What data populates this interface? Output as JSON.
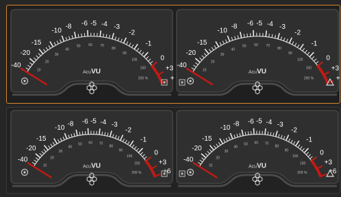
{
  "product": {
    "brand_prefix": "Acu",
    "brand_suffix": "VU"
  },
  "scale": {
    "labels": [
      "-40",
      "-20",
      "-15",
      "-10",
      "-8",
      "-6",
      "-5",
      "-4",
      "-3",
      "-2",
      "-1",
      "0",
      "+3",
      "+6"
    ],
    "percent_labels": [
      "10",
      "20",
      "30",
      "40",
      "50",
      "60",
      "70",
      "80",
      "90",
      "100",
      "150"
    ],
    "percent_end_label": "200 %"
  },
  "colors": {
    "panel": "#2f2f2f",
    "panel_bezel": "#3e3e3e",
    "scale_text": "#ffffff",
    "red_zone": "#c21a14",
    "needle": "#c21a14",
    "selected_border": "#d8882a"
  },
  "meters": [
    {
      "group": "top",
      "side": "left",
      "needle_db": -40
    },
    {
      "group": "top",
      "side": "right",
      "needle_db": -40
    },
    {
      "group": "bottom",
      "side": "left",
      "needle_db": -40
    },
    {
      "group": "bottom",
      "side": "right",
      "needle_db": -40
    }
  ],
  "icons": {
    "meter_bottom_left": "vu-settings-icon",
    "meter_bottom_center": "hexagon-cluster-icon",
    "meter_bottom_right_a": "level-mode-icon",
    "meter_bottom_right_b": "warning-triangle-icon"
  }
}
